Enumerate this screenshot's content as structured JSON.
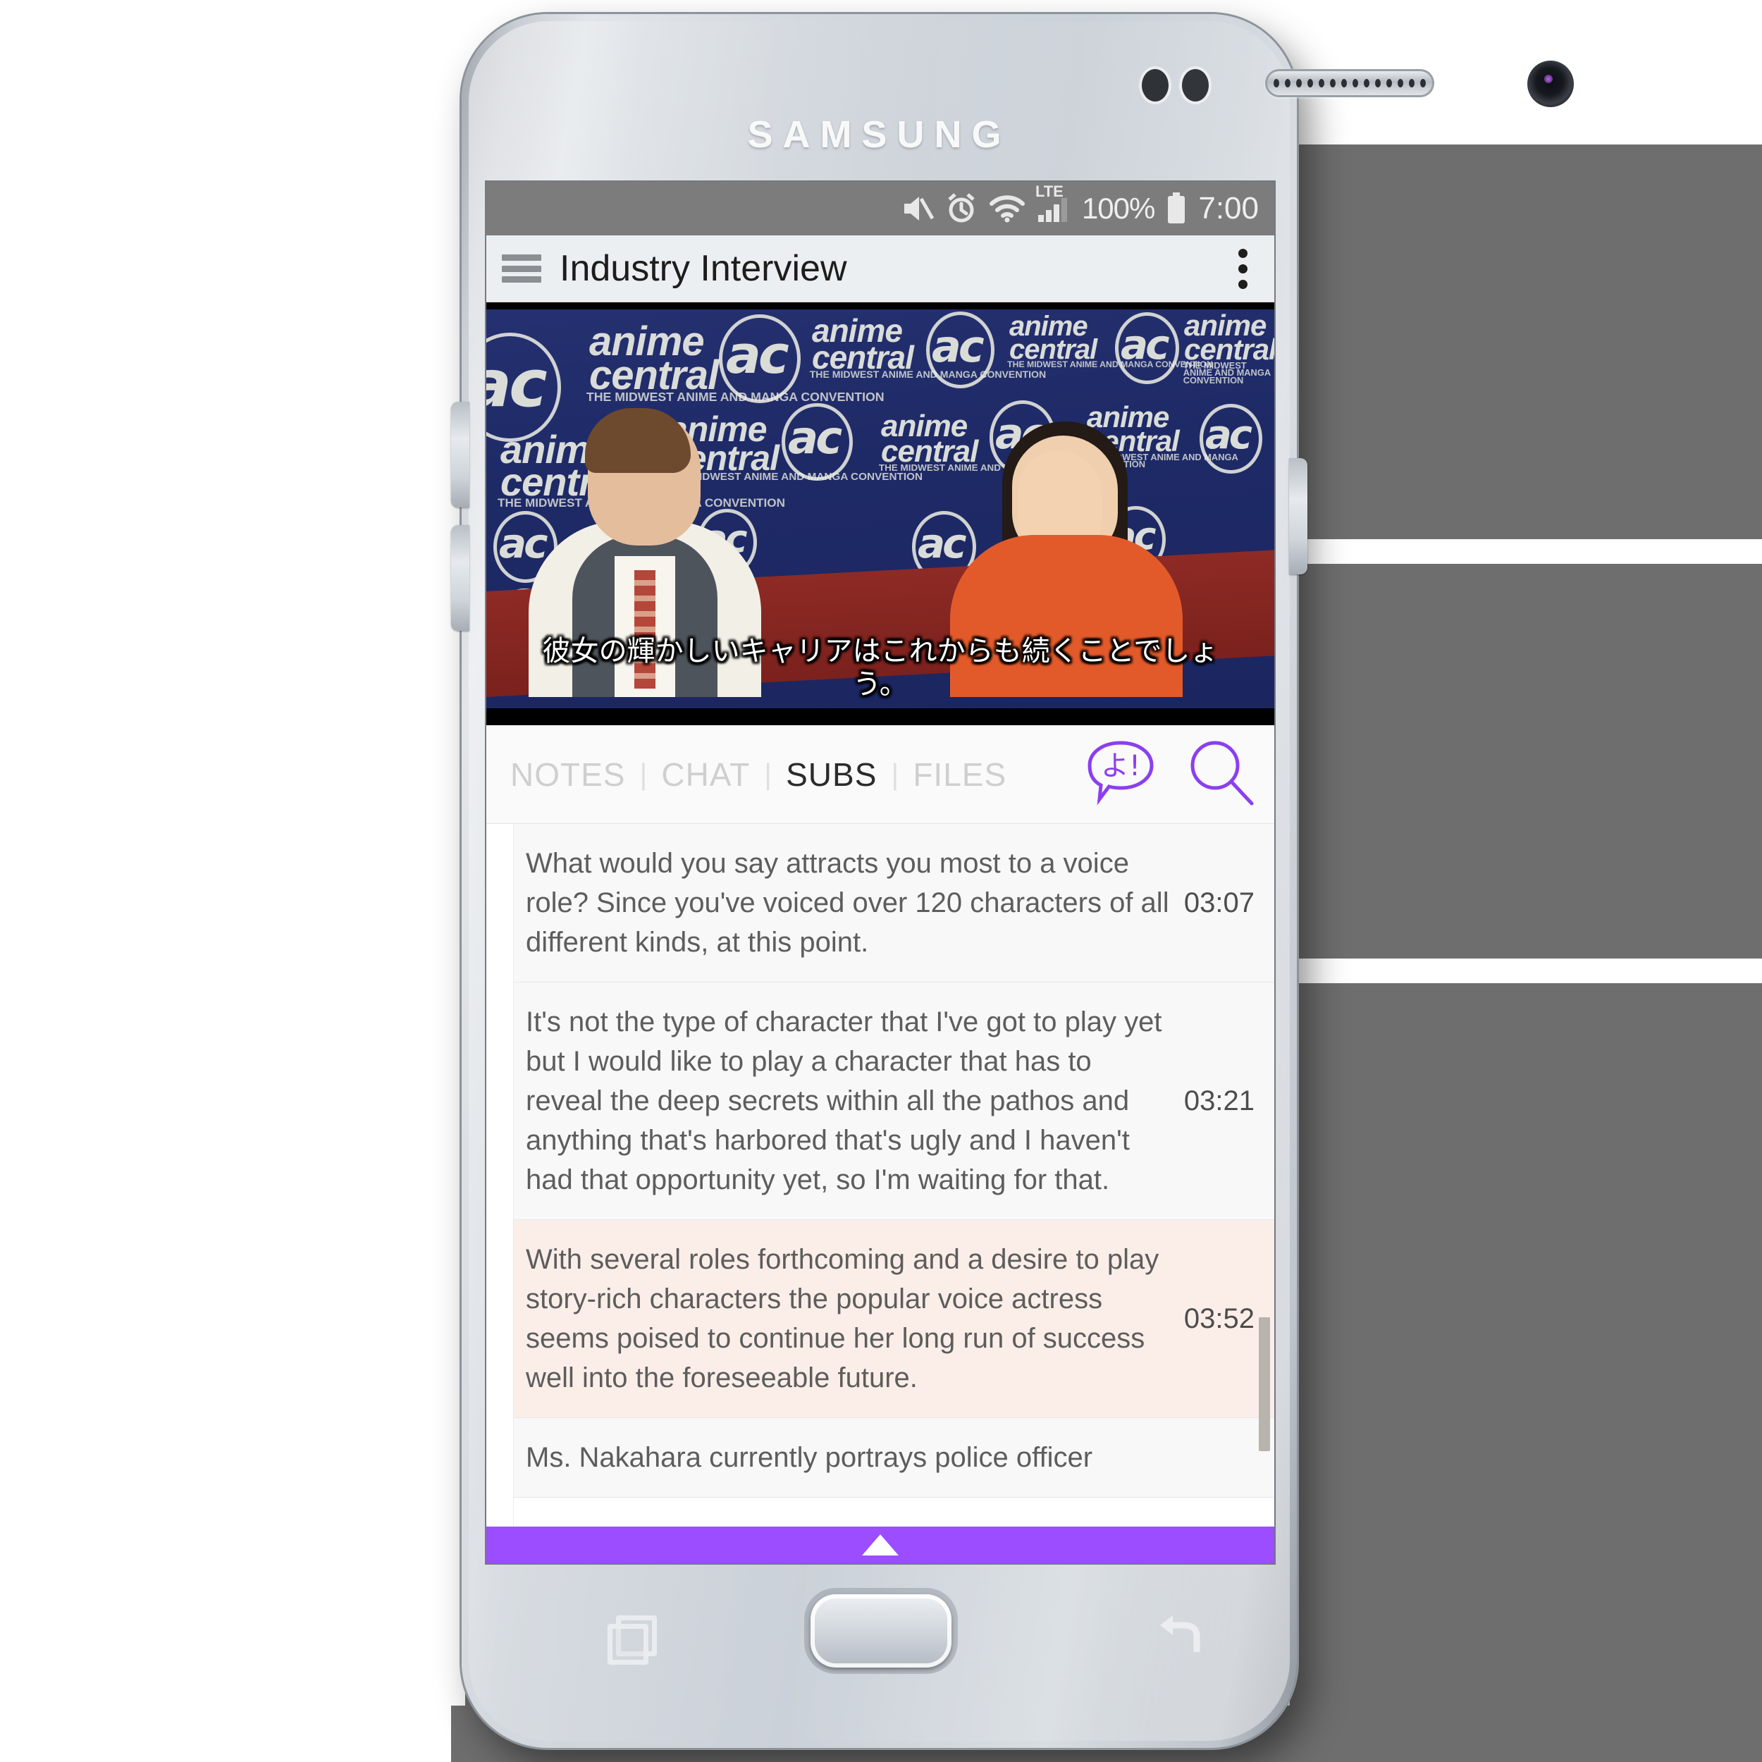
{
  "device": {
    "brand": "SAMSUNG",
    "icons": {
      "front_camera": "camera-icon",
      "speaker": "speaker-grille-icon",
      "proximity_sensor": "proximity-sensor-icon",
      "home": "home-button",
      "recents": "recents-icon",
      "back": "back-icon",
      "volume_up": "volume-up-button",
      "volume_down": "volume-down-button",
      "power": "power-button"
    }
  },
  "statusbar": {
    "mute_icon": "mute-icon",
    "alarm_icon": "alarm-icon",
    "wifi_icon": "wifi-icon",
    "network_label": "LTE",
    "signal_icon": "cellular-signal-icon",
    "battery_percent": "100%",
    "battery_icon": "battery-full-icon",
    "time": "7:00"
  },
  "appbar": {
    "menu_icon": "hamburger-menu-icon",
    "title": "Industry Interview",
    "overflow_icon": "overflow-menu-icon"
  },
  "video": {
    "subtitle_overlay": "彼女の輝かしいキャリアはこれからも続くことでしょう。",
    "backdrop_logos": [
      {
        "text": "ac",
        "kind": "ac"
      },
      {
        "text": "anime",
        "sub": "central",
        "tagline": "THE MIDWEST ANIME AND MANGA CONVENTION",
        "kind": "anime"
      }
    ],
    "backdrop_color": "#1e2a66",
    "table_color": "#8e2a25"
  },
  "tabs": {
    "items": [
      {
        "label": "NOTES",
        "active": false
      },
      {
        "label": "CHAT",
        "active": false
      },
      {
        "label": "SUBS",
        "active": true
      },
      {
        "label": "FILES",
        "active": false
      }
    ],
    "separator": "|",
    "actions": [
      {
        "name": "translate-bubble-icon",
        "glyph": "よ!",
        "color": "#8b3ff0"
      },
      {
        "name": "search-icon",
        "glyph": "search",
        "color": "#8b3ff0"
      }
    ],
    "accent_color": "#8b3ff0"
  },
  "subtitle_list": {
    "rows": [
      {
        "text": "What would you say attracts you most to a voice role? Since you've voiced over 120 characters of all different kinds, at this point.",
        "time": "03:07",
        "current": false
      },
      {
        "text": "It's not the type of character that I've got to play yet but I would like to play a character that has to reveal the deep secrets within all the pathos and anything that's harbored that's ugly and I haven't had that opportunity yet, so I'm waiting for that.",
        "time": "03:21",
        "current": false
      },
      {
        "text": "With several roles forthcoming and a desire to play story-rich characters the popular voice actress seems poised to continue her long run of success well into the foreseeable future.",
        "time": "03:52",
        "current": true
      },
      {
        "text": "Ms. Nakahara currently portrays police officer",
        "time": "",
        "current": false
      }
    ],
    "highlight_color": "#fbeee8",
    "scrollbar": "vertical-scrollbar"
  },
  "handle_bar": {
    "name": "expand-panel-handle",
    "arrow_icon": "chevron-up-icon",
    "color": "#9b4dff"
  }
}
